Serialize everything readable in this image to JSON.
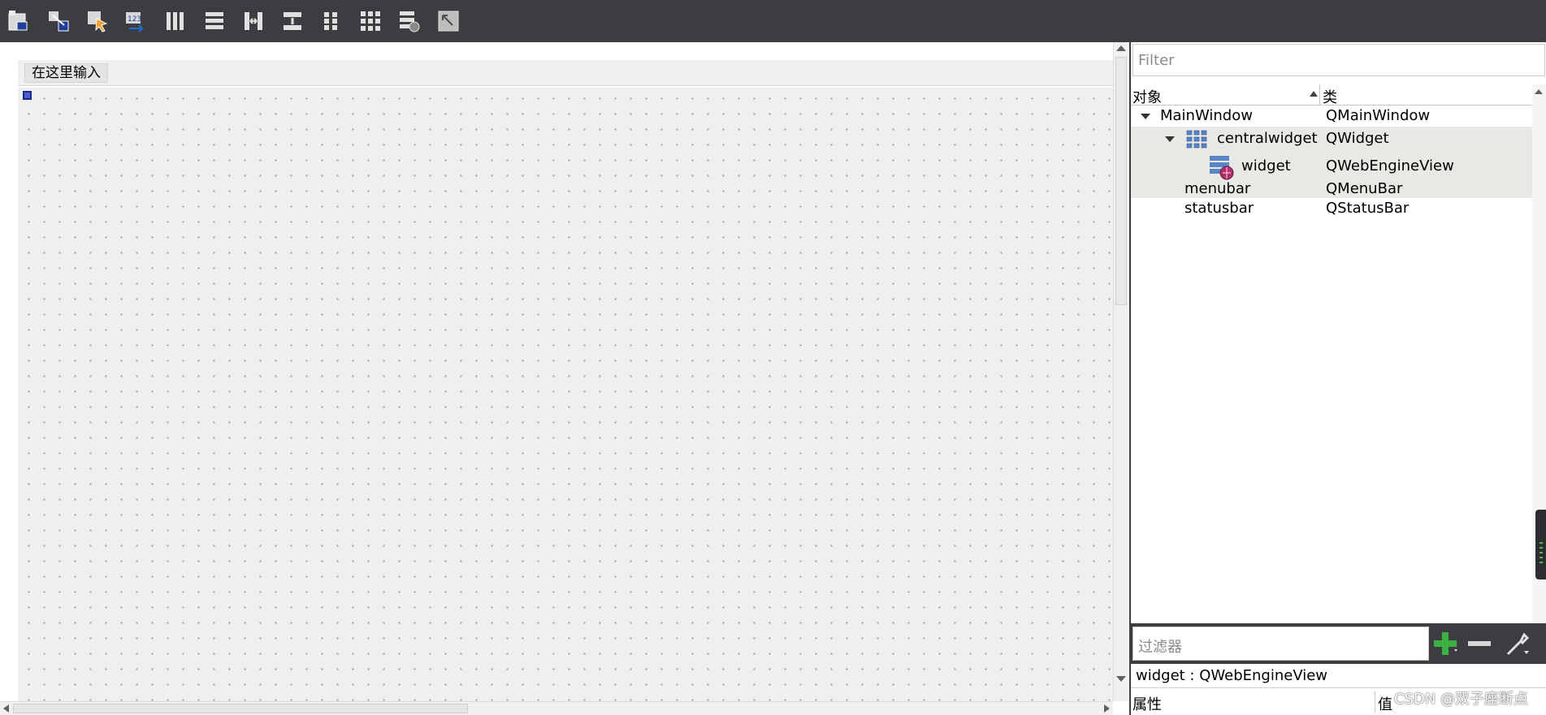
{
  "toolbar": {
    "buttons": [
      {
        "name": "edit-widgets",
        "icon": "edit-widgets-icon"
      },
      {
        "name": "edit-signals-slots",
        "icon": "signals-slots-icon"
      },
      {
        "name": "edit-buddies",
        "icon": "buddies-icon"
      },
      {
        "name": "edit-tab-order",
        "icon": "tab-order-icon"
      },
      {
        "name": "layout-horizontal",
        "icon": "layout-horizontal-icon"
      },
      {
        "name": "layout-vertical",
        "icon": "layout-vertical-icon"
      },
      {
        "name": "layout-horizontal-splitter",
        "icon": "h-splitter-icon"
      },
      {
        "name": "layout-vertical-splitter",
        "icon": "v-splitter-icon"
      },
      {
        "name": "layout-form",
        "icon": "form-layout-icon"
      },
      {
        "name": "layout-grid",
        "icon": "grid-layout-icon"
      },
      {
        "name": "break-layout",
        "icon": "break-layout-icon"
      },
      {
        "name": "adjust-size",
        "icon": "adjust-size-icon"
      }
    ]
  },
  "form": {
    "menu_placeholder": "在这里输入"
  },
  "object_inspector": {
    "filter_placeholder": "Filter",
    "header": {
      "object": "对象",
      "class": "类"
    },
    "rows": [
      {
        "object": "MainWindow",
        "class": "QMainWindow"
      },
      {
        "object": "centralwidget",
        "class": "QWidget"
      },
      {
        "object": "widget",
        "class": "QWebEngineView"
      },
      {
        "object": "menubar",
        "class": "QMenuBar"
      },
      {
        "object": "statusbar",
        "class": "QStatusBar"
      }
    ]
  },
  "property_editor": {
    "filter_placeholder": "过滤器",
    "title": "widget : QWebEngineView",
    "header": {
      "property": "属性",
      "value": "值"
    }
  },
  "watermark": "CSDN @双子座断点",
  "colors": {
    "toolbar_bg": "#3b3d40",
    "canvas_bg": "#efefef",
    "alt_row": "#e9e8e4",
    "selection_handle": "#4a5fd0",
    "add_green": "#3cb043"
  }
}
